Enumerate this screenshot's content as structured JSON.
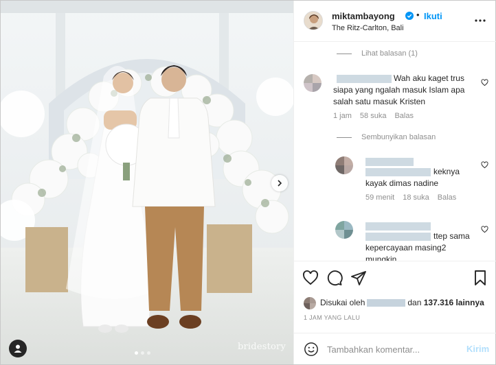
{
  "post": {
    "username": "miktambayong",
    "follow_label": "Ikuti",
    "location": "The Ritz-Carlton, Bali",
    "watermark": "bridestory",
    "carousel": {
      "slides": 3,
      "active": 0
    }
  },
  "comments": {
    "view_replies": "Lihat balasan (1)",
    "hide_replies": "Sembunyikan balasan",
    "items": [
      {
        "text_line1": "Wah aku kaget trus",
        "text_line2": "siapa yang ngalah masuk Islam apa",
        "text_line3": "salah satu masuk Kristen",
        "time": "1 jam",
        "likes": "58 suka",
        "reply": "Balas"
      },
      {
        "text_line1": "keknya",
        "text_line2": "kayak dimas nadine",
        "time": "59 menit",
        "likes": "18 suka",
        "reply": "Balas"
      },
      {
        "text_line1": "ttep sama",
        "text_line2": "kepercayaan masing2",
        "text_line3": "mungkin"
      }
    ]
  },
  "likes": {
    "prefix": "Disukai oleh",
    "connector": "dan",
    "count": "137.316 lainnya"
  },
  "time_ago": "1 JAM YANG LALU",
  "composer": {
    "placeholder": "Tambahkan komentar...",
    "post_label": "Kirim"
  },
  "icons": {
    "heart": "heart-icon",
    "comment": "comment-icon",
    "share": "share-icon",
    "save": "bookmark-icon",
    "emoji": "emoji-icon",
    "more": "more-icon",
    "verified": "verified-badge-icon"
  },
  "colors": {
    "accent": "#0095f6",
    "post_disabled": "#b2dffc",
    "muted": "#8e8e8e"
  }
}
